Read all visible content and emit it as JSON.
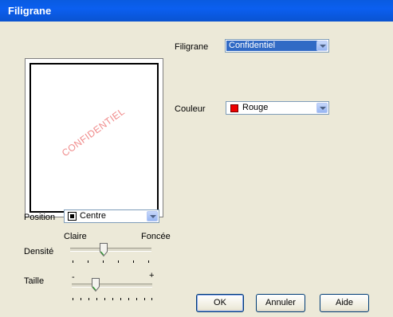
{
  "window": {
    "title": "Filigrane"
  },
  "watermark": {
    "label": "Filigrane",
    "selected": "Confidentiel"
  },
  "color": {
    "label": "Couleur",
    "selected": "Rouge",
    "swatch_hex": "#e00000"
  },
  "preview": {
    "watermark_text": "CONFIDENTIEL",
    "watermark_color": "#f08a8a"
  },
  "position": {
    "label": "Position",
    "selected": "Centre"
  },
  "density": {
    "label": "Densité",
    "min_label": "Claire",
    "max_label": "Foncée",
    "level_fraction": 0.4
  },
  "size": {
    "label": "Taille",
    "min_label": "-",
    "max_label": "+",
    "level_fraction": 0.27
  },
  "buttons": {
    "ok": "OK",
    "cancel": "Annuler",
    "help": "Aide"
  }
}
